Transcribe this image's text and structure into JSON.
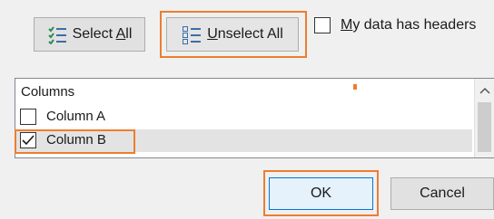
{
  "toolbar": {
    "select_all_label": "Select All",
    "unselect_all_label": "Unselect All",
    "headers_checkbox_label": "My data has headers",
    "headers_checked": false
  },
  "columns_list": {
    "header": "Columns",
    "items": [
      {
        "label": "Column A",
        "checked": false
      },
      {
        "label": "Column B",
        "checked": true
      }
    ]
  },
  "footer": {
    "ok_label": "OK",
    "cancel_label": "Cancel"
  },
  "colors": {
    "highlight": "#ed7d31",
    "focus_border": "#0078d7",
    "selected_row": "#e3e3e3"
  },
  "icons": {
    "select_all": "select-all-icon",
    "unselect_all": "unselect-all-icon",
    "check": "check-mark-icon",
    "scroll_up": "chevron-up-icon"
  }
}
